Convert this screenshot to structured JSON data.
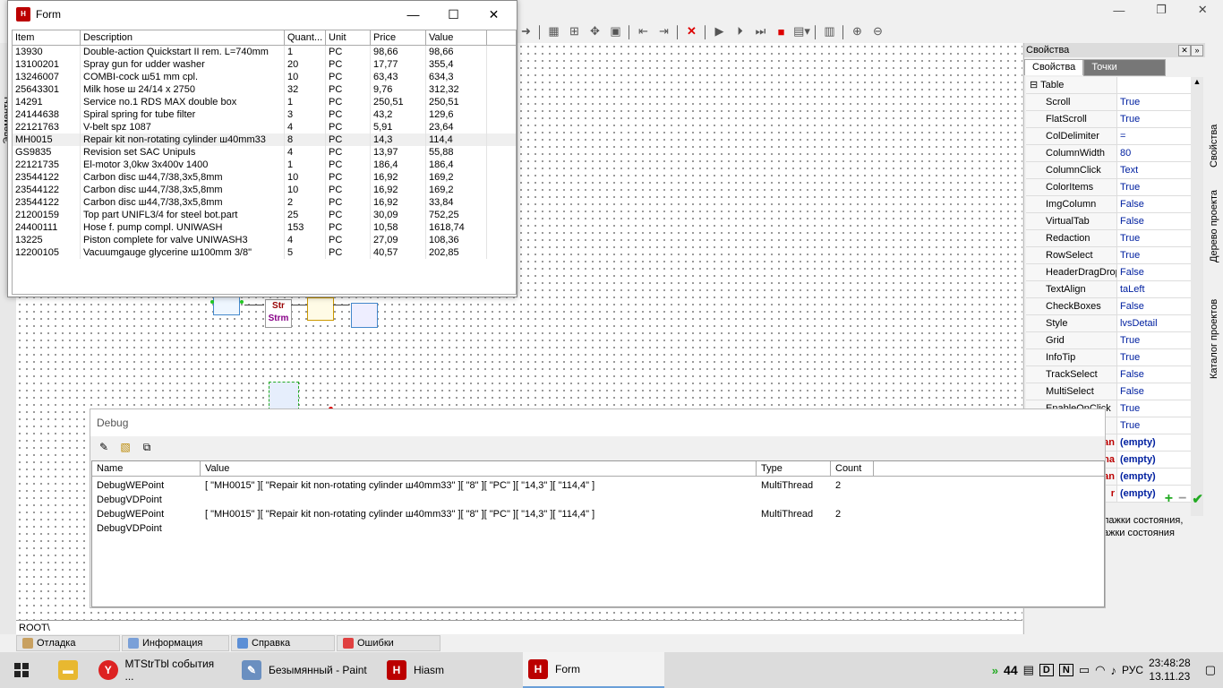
{
  "form_window": {
    "title": "Form",
    "columns": [
      "Item",
      "Description",
      "Quant...",
      "Unit",
      "Price",
      "Value"
    ],
    "rows": [
      [
        "13930",
        "Double-action Quickstart II rem. L=740mm",
        "1",
        "PC",
        "98,66",
        "98,66"
      ],
      [
        "13100201",
        "Spray gun for udder washer",
        "20",
        "PC",
        "17,77",
        "355,4"
      ],
      [
        "13246007",
        "COMBI-cock ш51 mm cpl.",
        "10",
        "PC",
        "63,43",
        "634,3"
      ],
      [
        "25643301",
        "Milk hose ш 24/14 x 2750",
        "32",
        "PC",
        "9,76",
        "312,32"
      ],
      [
        "14291",
        "Service no.1 RDS MAX double box",
        "1",
        "PC",
        "250,51",
        "250,51"
      ],
      [
        "24144638",
        "Spiral spring for tube filter",
        "3",
        "PC",
        "43,2",
        "129,6"
      ],
      [
        "22121763",
        "V-belt spz 1087",
        "4",
        "PC",
        "5,91",
        "23,64"
      ],
      [
        "MH0015",
        "Repair kit non-rotating cylinder ш40mm33",
        "8",
        "PC",
        "14,3",
        "114,4"
      ],
      [
        "GS9835",
        "Revision set SAC Unipuls",
        "4",
        "PC",
        "13,97",
        "55,88"
      ],
      [
        "22121735",
        "El-motor 3,0kw 3x400v 1400",
        "1",
        "PC",
        "186,4",
        "186,4"
      ],
      [
        "23544122",
        "Carbon disc ш44,7/38,3x5,8mm",
        "10",
        "PC",
        "16,92",
        "169,2"
      ],
      [
        "23544122",
        "Carbon disc ш44,7/38,3x5,8mm",
        "10",
        "PC",
        "16,92",
        "169,2"
      ],
      [
        "23544122",
        "Carbon disc ш44,7/38,3x5,8mm",
        "2",
        "PC",
        "16,92",
        "33,84"
      ],
      [
        "21200159",
        "Top part UNIFL3/4 for steel bot.part",
        "25",
        "PC",
        "30,09",
        "752,25"
      ],
      [
        "24400111",
        "Hose f. pump compl. UNIWASH",
        "153",
        "PC",
        "10,58",
        "1618,74"
      ],
      [
        "13225",
        "Piston complete for valve UNIWASH3",
        "4",
        "PC",
        "27,09",
        "108,36"
      ],
      [
        "12200105",
        "Vacuumgauge glycerine ш100mm 3/8\"",
        "5",
        "PC",
        "40,57",
        "202,85"
      ]
    ]
  },
  "canvas_nodes": {
    "str_strm_top": "Str",
    "str_strm_bottom": "Strm"
  },
  "debug_window": {
    "title": "Debug",
    "columns": [
      "Name",
      "Value",
      "Type",
      "Count"
    ],
    "rows": [
      {
        "name1": "DebugWEPoint",
        "name2": "DebugVDPoint",
        "value": "[ \"MH0015\" ][ \"Repair kit non-rotating cylinder ш40mm33\" ][ \"8\" ][ \"PC\" ][ \"14,3\" ][ \"114,4\" ]",
        "type": "MultiThread",
        "count": "2"
      },
      {
        "name1": "DebugWEPoint",
        "name2": "DebugVDPoint",
        "value": "[ \"MH0015\" ][ \"Repair kit non-rotating cylinder ш40mm33\" ][ \"8\" ][ \"PC\" ][ \"14,3\" ][ \"114,4\" ]",
        "type": "MultiThread",
        "count": "2"
      }
    ]
  },
  "properties_panel": {
    "title": "Свойства",
    "tabs": [
      "Свойства",
      "Точки"
    ],
    "group_label": "Table",
    "props": [
      {
        "name": "Scroll",
        "value": "True"
      },
      {
        "name": "FlatScroll",
        "value": "True"
      },
      {
        "name": "ColDelimiter",
        "value": "="
      },
      {
        "name": "ColumnWidth",
        "value": "80"
      },
      {
        "name": "ColumnClick",
        "value": "Text"
      },
      {
        "name": "ColorItems",
        "value": "True"
      },
      {
        "name": "ImgColumn",
        "value": "False"
      },
      {
        "name": "VirtualTab",
        "value": "False"
      },
      {
        "name": "Redaction",
        "value": "True"
      },
      {
        "name": "RowSelect",
        "value": "True"
      },
      {
        "name": "HeaderDragDrop",
        "value": "False"
      },
      {
        "name": "TextAlign",
        "value": "taLeft"
      },
      {
        "name": "CheckBoxes",
        "value": "False"
      },
      {
        "name": "Style",
        "value": "lvsDetail"
      },
      {
        "name": "Grid",
        "value": "True"
      },
      {
        "name": "InfoTip",
        "value": "True"
      },
      {
        "name": "TrackSelect",
        "value": "False"
      },
      {
        "name": "MultiSelect",
        "value": "False"
      },
      {
        "name": "EnableOnClick",
        "value": "True"
      },
      {
        "name": "ChangeWidth",
        "value": "True"
      }
    ],
    "extra_rows": [
      {
        "name": "an",
        "value": "(empty)"
      },
      {
        "name": "na",
        "value": "(empty)"
      },
      {
        "name": "an",
        "value": "(empty)"
      },
      {
        "name": "r",
        "value": "(empty)"
      }
    ],
    "hint_line1": "лажки состояния,",
    "hint_line2": "ажки состояния"
  },
  "side_tabs": [
    "Свойства",
    "Дерево проекта",
    "Каталог проектов"
  ],
  "left_strip_label": "Элементы",
  "root_path": "ROOT\\",
  "bottom_tabs": [
    "Отладка",
    "Информация",
    "Справка",
    "Ошибки"
  ],
  "taskbar": {
    "apps": [
      "MTStrTbl события ...",
      "Безымянный - Paint",
      "Hiasm",
      "Form"
    ],
    "tray_count": "44",
    "lang": "РУС",
    "time": "23:48:28",
    "date": "13.11.23"
  },
  "colors": {
    "accent": "#2c2",
    "prop_value": "#0020a0",
    "stop_red": "#d00"
  }
}
